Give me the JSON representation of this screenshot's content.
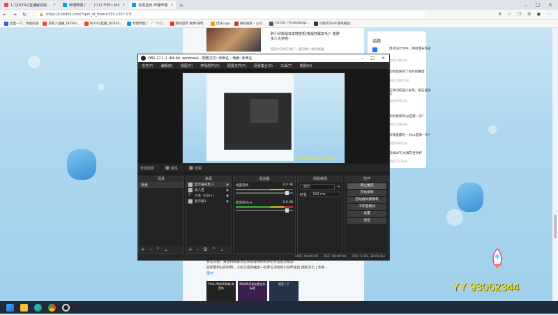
{
  "browser": {
    "tabs": [
      {
        "label": "1-刀DOTA2直播解说经...",
        "color": "#e64a4a",
        "active": false
      },
      {
        "label": "哔哩哔哩 (゜-゜)つロ 干杯~-bili",
        "color": "#00a1d6",
        "active": false
      },
      {
        "label": "动态首页-哔哩哔哩",
        "color": "#00a1d6",
        "active": true
      }
    ],
    "new_tab_icon": "plus-icon",
    "url": "https://t.bilibili.com/?spm_id_from=333.1007.0.0",
    "bookmarks": [
      "百度一下，你就知道",
      "求职人直播_DOTA2...",
      "DOTA2直播_DOTA2...",
      "哔哩哔哩 (゜-゜)つロ...",
      "我的首页 微博-随时...",
      "虎牙csgo",
      "微软搜索 - 公众...",
      "CS:GO | ProSettings...",
      "问卷可SUFF游戏挑战..."
    ]
  },
  "page": {
    "article_title": "胖小伙挑战日本娃娃机(挑战狂踩羊毛)！能胖多少大奖呢！",
    "article_sub": "最近今天终于做了一把日本人如何被骗",
    "trending_title": "话题",
    "trending": [
      {
        "title": "周考前计时中，用林瀑布完成",
        "stat": "浏览4786讨论"
      },
      {
        "title": "如何能获到了你的的魔塔",
        "stat": "浏览11862讨论"
      },
      {
        "title": "在你的校园小发现，能在喜欢什",
        "stat": "浏览8672讨论"
      },
      {
        "title": "如何要真的cp是哪一对?",
        "stat": "浏览7438讨论"
      },
      {
        "title": "好像里最的一对cp是哪一对?",
        "stat": "浏览4482讨论"
      },
      {
        "title": "假如WTC大赛车世界杯",
        "stat": "浏览2157讨论"
      }
    ],
    "below_lines": [
      "参与方式：关注抖映美文坛多提得到你的评论点击此次投票",
      "后积累积分的同时，小伙子还将抽出一位参与活动的小伙伴送出 随影双七 | 多看..."
    ],
    "expand_link": "展开",
    "cards": [
      "FULL MAJOR领域 有竞争",
      "MAJOR开始比赛全实际地",
      "周至一下"
    ]
  },
  "obs": {
    "title": "OBS 27.1.1 (64-bit, windows) - 配置文件: 未命名 - 场景: 未命名",
    "menu": [
      "文件(F)",
      "编辑(E)",
      "视图(V)",
      "停靠部件(D)",
      "配置文件(P)",
      "场景集合(S)",
      "工具(T)",
      "帮助(H)"
    ],
    "source_bar": {
      "no_source": "未选择源",
      "properties": "属性",
      "filters": "滤镜"
    },
    "docks": {
      "scenes": {
        "header": "场景",
        "items": [
          "场景"
        ]
      },
      "sources": {
        "header": "来源",
        "items": [
          "显示器采集 2",
          "高八室",
          "文本（GDI+）",
          "显示器1"
        ]
      },
      "mixer": {
        "header": "混音器",
        "channels": [
          {
            "name": "桌面音频",
            "db": "0.0 dB"
          },
          {
            "name": "麦克风/Aux",
            "db": "0.0 dB"
          }
        ]
      },
      "transitions": {
        "header": "场景转场",
        "type": "淡出",
        "duration_label": "时长",
        "duration": "300 ms"
      },
      "controls": {
        "header": "控件",
        "buttons": [
          "停止推流",
          "开始录制",
          "启动虚拟摄像机",
          "工作室模式",
          "设置",
          "退出"
        ]
      }
    },
    "status": {
      "live": "LIVE: 00:00:00",
      "rec": "REC: 00:00:00",
      "cpu": "CPU: 0.1%, 30.00 fps"
    },
    "preview_watermark": "YY 93062344 铁血三国雪"
  },
  "overlay": {
    "line1": "YY 93062344",
    "line2": "铁血三国雪 61726/327"
  },
  "colors": {
    "accent": "#1a78ff",
    "watermark": "#ffe600",
    "obs_bg": "#1f1f1f"
  }
}
